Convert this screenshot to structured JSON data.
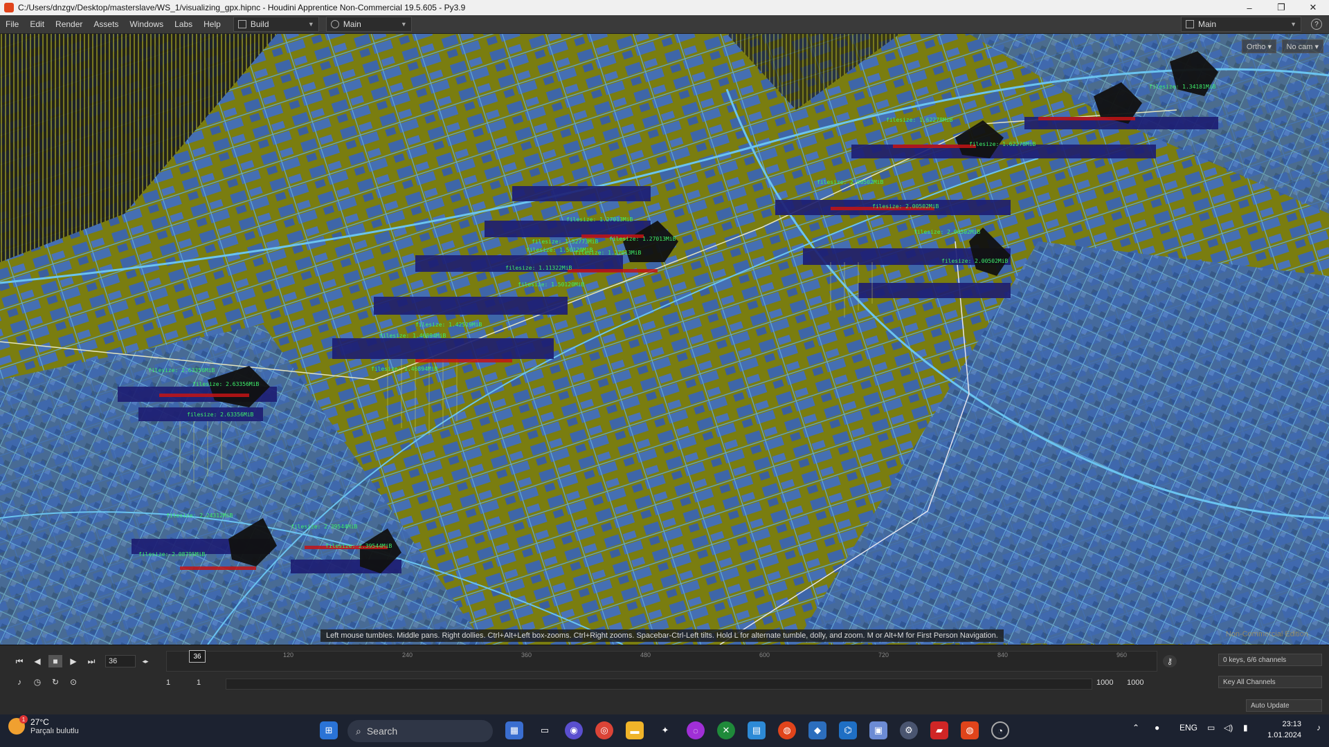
{
  "window": {
    "title": "C:/Users/dnzgv/Desktop/masterslave/WS_1/visualizing_gpx.hipnc - Houdini Apprentice Non-Commercial 19.5.605 - Py3.9",
    "minimize": "–",
    "maximize": "❐",
    "close": "✕"
  },
  "menubar": {
    "items": [
      "File",
      "Edit",
      "Render",
      "Assets",
      "Windows",
      "Labs",
      "Help"
    ],
    "desktop_build": "Build",
    "desktop_main": "Main",
    "right_desktop": "Main"
  },
  "viewport": {
    "camera_buttons": [
      "Ortho ▾",
      "No cam ▾"
    ],
    "hint": "Left mouse tumbles. Middle pans. Right dollies. Ctrl+Alt+Left box-zooms. Ctrl+Right zooms. Spacebar-Ctrl-Left tilts. Hold L for alternate tumble, dolly, and zoom.     M or Alt+M for First Person Navigation.",
    "noncommercial": "Non-Commercial Edition",
    "labels": [
      "filesize: 1.27013MiB",
      "filesize: 1.27013MiB",
      "filesize: 1.27013MiB",
      "filesize: 1.52773MiB",
      "filesize: 1.50120MiB",
      "filesize: 1.11322MiB",
      "filesize: 1.50120MiB",
      "filesize: 1.42519MiB",
      "filesize: 1.46894MiB",
      "filesize: 1.46894MiB",
      "filesize: 2.63356MiB",
      "filesize: 2.63356MiB",
      "filesize: 2.63356MiB",
      "filesize: 2.39544MiB",
      "filesize: 2.39544MiB",
      "filesize: 2.24312MiB",
      "filesize: 2.08795MiB",
      "filesize: 1.62278MiB",
      "filesize: 1.62278MiB",
      "filesize: 2.00502MiB",
      "filesize: 2.00502MiB",
      "filesize: 2.00502MiB",
      "filesize: 1.34181MiB",
      "filesize: 2.00502MiB"
    ]
  },
  "timeline": {
    "current_frame": "36",
    "playhead": "36",
    "ticks": [
      "120",
      "240",
      "360",
      "480",
      "600",
      "720",
      "840",
      "960"
    ],
    "range_start": "1",
    "range_start2": "1",
    "range_end": "1000",
    "range_end2": "1000",
    "keys_info": "0 keys, 6/6 channels",
    "key_all": "Key All Channels",
    "auto_update": "Auto Update"
  },
  "taskbar": {
    "weather_temp": "27°C",
    "weather_desc": "Parçalı bulutlu",
    "weather_badge": "1",
    "search": "Search",
    "lang": "ENG",
    "time": "23:13",
    "date": "1.01.2024"
  }
}
